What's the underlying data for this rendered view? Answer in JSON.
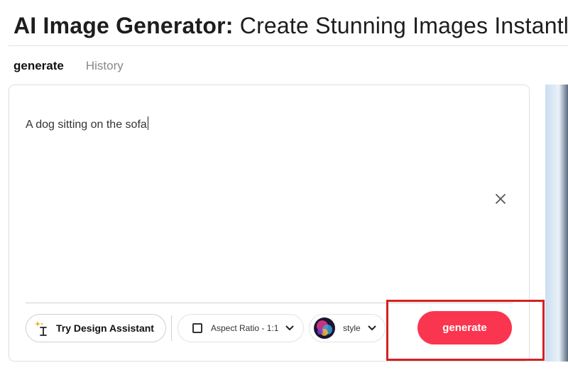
{
  "header": {
    "title_strong": "AI Image Generator:",
    "title_rest": " Create Stunning Images Instantly"
  },
  "tabs": [
    {
      "label": "generate",
      "active": true
    },
    {
      "label": "History",
      "active": false
    }
  ],
  "prompt": {
    "value": "A dog sitting on the sofa"
  },
  "toolbar": {
    "assistant_label": "Try Design Assistant",
    "aspect_label": "Aspect Ratio - 1:1",
    "style_label": "style",
    "generate_label": "generate"
  },
  "icons": {
    "assistant": "sparkle-cursor-icon",
    "clear": "close-icon",
    "aspect": "checkbox-icon",
    "dropdown": "chevron-down-icon"
  },
  "colors": {
    "accent": "#fa3550",
    "highlight": "#d42121"
  }
}
